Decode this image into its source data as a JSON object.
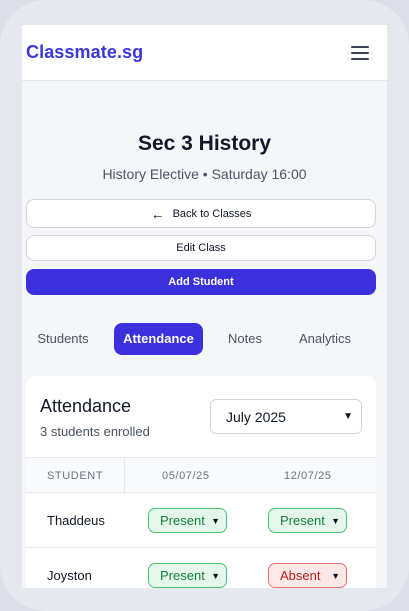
{
  "app": {
    "brand": "Classmate.sg"
  },
  "class": {
    "title": "Sec 3 History",
    "subtitle": "History Elective • Saturday 16:00"
  },
  "actions": {
    "back_label": "Back to Classes",
    "edit_label": "Edit Class",
    "add_label": "Add Student"
  },
  "tabs": [
    {
      "label": "Students"
    },
    {
      "label": "Attendance",
      "active": true
    },
    {
      "label": "Notes"
    },
    {
      "label": "Analytics"
    }
  ],
  "attendance": {
    "title": "Attendance",
    "count": "3 students enrolled",
    "month": "July 2025",
    "columns": [
      "STUDENT",
      "05/07/25",
      "12/07/25"
    ],
    "rows": [
      {
        "name": "Thaddeus",
        "statuses": [
          "Present",
          "Present"
        ]
      },
      {
        "name": "Joyston",
        "statuses": [
          "Present",
          "Absent"
        ]
      }
    ]
  },
  "colors": {
    "accent": "#3b30dc",
    "present": "#15803d",
    "absent": "#b91c1c"
  }
}
